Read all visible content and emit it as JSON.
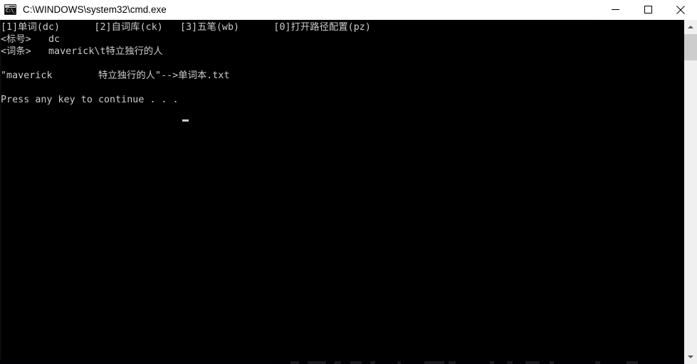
{
  "window": {
    "title": "C:\\WINDOWS\\system32\\cmd.exe",
    "icon_name": "cmd-icon",
    "icon_glyph": "C:\\_",
    "background_color": "#000000",
    "titlebar_color": "#ffffff",
    "text_color": "#cccccc"
  },
  "titlebar_buttons": {
    "minimize_label": "Minimize",
    "maximize_label": "Maximize",
    "close_label": "Close"
  },
  "console": {
    "lines": [
      "[1]单词(dc)      [2]自词库(ck)   [3]五笔(wb)      [0]打开路径配置(pz)",
      "<标号>   dc",
      "<词条>   maverick\\t特立独行的人",
      "",
      "\"maverick        特立独行的人\"-->单词本.txt",
      "",
      "Press any key to continue . . . "
    ],
    "full_text": "[1]单词(dc)      [2]自词库(ck)   [3]五笔(wb)      [0]打开路径配置(pz)\n<标号>   dc\n<词条>   maverick\\t特立独行的人\n\n\"maverick        特立独行的人\"-->单词本.txt\n\nPress any key to continue . . . ",
    "menu_items": [
      {
        "key": "1",
        "label": "单词",
        "command": "dc"
      },
      {
        "key": "2",
        "label": "自词库",
        "command": "ck"
      },
      {
        "key": "3",
        "label": "五笔",
        "command": "wb"
      },
      {
        "key": "0",
        "label": "打开路径配置",
        "command": "pz"
      }
    ],
    "prompts": [
      {
        "label": "<标号>",
        "value": "dc"
      },
      {
        "label": "<词条>",
        "value": "maverick\\t特立独行的人"
      }
    ],
    "result_line": "\"maverick        特立独行的人\"-->单词本.txt",
    "output_file": "单词本.txt",
    "status_line": "Press any key to continue . . .",
    "cursor_visible": true
  },
  "scrollbar": {
    "up_arrow_name": "scroll-up-arrow",
    "down_arrow_name": "scroll-down-arrow",
    "thumb_name": "scroll-thumb"
  }
}
